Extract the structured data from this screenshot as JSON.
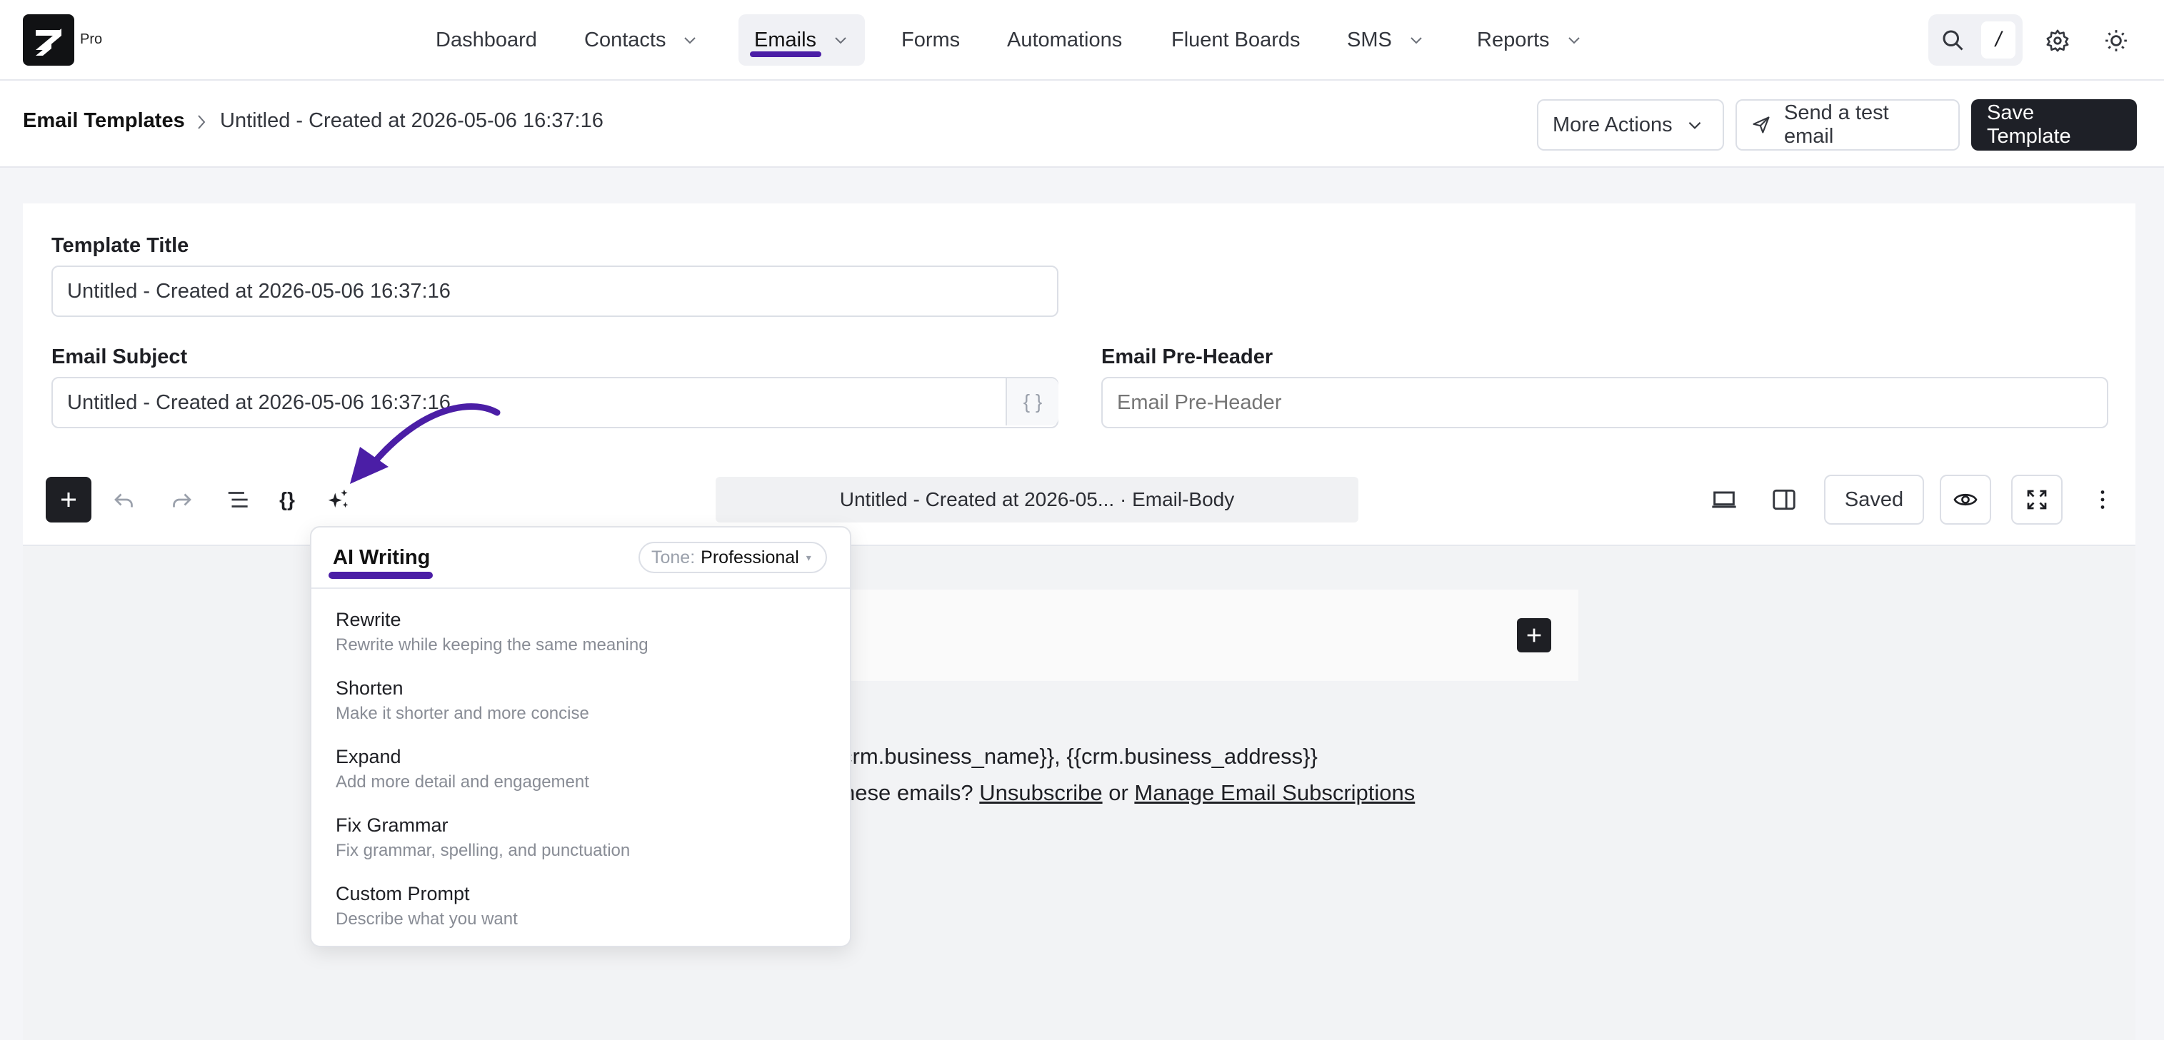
{
  "brand": {
    "badge": "Pro"
  },
  "nav": {
    "items": [
      {
        "label": "Dashboard",
        "has_dropdown": false,
        "active": false
      },
      {
        "label": "Contacts",
        "has_dropdown": true,
        "active": false
      },
      {
        "label": "Emails",
        "has_dropdown": true,
        "active": true
      },
      {
        "label": "Forms",
        "has_dropdown": false,
        "active": false
      },
      {
        "label": "Automations",
        "has_dropdown": false,
        "active": false
      },
      {
        "label": "Fluent Boards",
        "has_dropdown": false,
        "active": false
      },
      {
        "label": "SMS",
        "has_dropdown": true,
        "active": false
      },
      {
        "label": "Reports",
        "has_dropdown": true,
        "active": false
      }
    ],
    "right_icons": [
      "search-icon",
      "slash-shortcut-icon",
      "settings-gear-icon",
      "theme-sun-icon"
    ],
    "shortcut_key": "/"
  },
  "header": {
    "breadcrumb_root": "Email Templates",
    "breadcrumb_current": "Untitled - Created at 2026-05-06 16:37:16",
    "more_actions": "More Actions",
    "send_test": "Send a test email",
    "save": "Save Template"
  },
  "form": {
    "title_label": "Template Title",
    "title_value": "Untitled - Created at 2026-05-06 16:37:16",
    "subject_label": "Email Subject",
    "subject_value": "Untitled - Created at 2026-05-06 16:37:16",
    "subject_smartcode": "{ }",
    "preheader_label": "Email Pre-Header",
    "preheader_placeholder": "Email Pre-Header"
  },
  "editor": {
    "doc_title": "Untitled - Created at 2026-05... · Email-Body",
    "saved_label": "Saved",
    "toolbar_icons": [
      "add-block-icon",
      "undo-icon",
      "redo-icon",
      "list-view-icon",
      "smartcode-icon",
      "ai-sparkles-icon"
    ],
    "right_icons": [
      "desktop-preview-icon",
      "sidebar-toggle-icon",
      "preview-eye-icon",
      "fullscreen-icon",
      "more-vertical-icon"
    ]
  },
  "canvas": {
    "footer_line1_visible": "crm.business_name}}, {{crm.business_address}}",
    "footer_line2_visible": "nese emails? ",
    "unsubscribe": "Unsubscribe",
    "or": " or ",
    "manage": "Manage Email Subscriptions"
  },
  "ai_menu": {
    "title": "AI Writing",
    "tone_label": "Tone:",
    "tone_value": "Professional",
    "items": [
      {
        "title": "Rewrite",
        "desc": "Rewrite while keeping the same meaning"
      },
      {
        "title": "Shorten",
        "desc": "Make it shorter and more concise"
      },
      {
        "title": "Expand",
        "desc": "Add more detail and engagement"
      },
      {
        "title": "Fix Grammar",
        "desc": "Fix grammar, spelling, and punctuation"
      },
      {
        "title": "Custom Prompt",
        "desc": "Describe what you want"
      }
    ]
  },
  "colors": {
    "accent": "#4b1ea6",
    "dark": "#1e2027",
    "border": "#dcdfe6"
  }
}
